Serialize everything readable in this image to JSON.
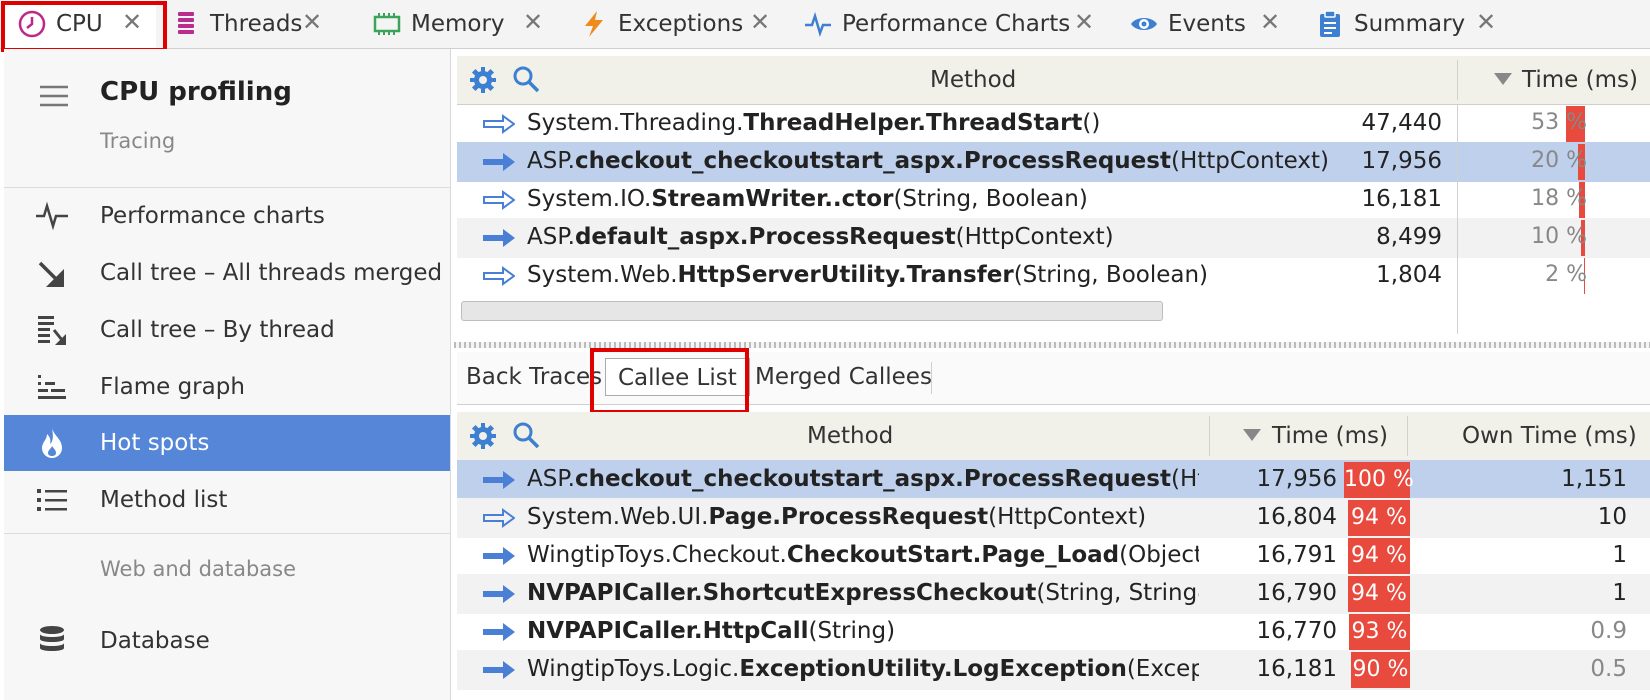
{
  "tabs": [
    {
      "label": "CPU",
      "icon": "clock-icon",
      "active": true
    },
    {
      "label": "Threads",
      "icon": "threads-icon",
      "active": false
    },
    {
      "label": "Memory",
      "icon": "memory-icon",
      "active": false
    },
    {
      "label": "Exceptions",
      "icon": "lightning-icon",
      "active": false
    },
    {
      "label": "Performance Charts",
      "icon": "pulse-icon",
      "active": false
    },
    {
      "label": "Events",
      "icon": "eye-icon",
      "active": false
    },
    {
      "label": "Summary",
      "icon": "clipboard-icon",
      "active": false
    }
  ],
  "tab_close_glyph": "✕",
  "sidebar": {
    "title": "CPU profiling",
    "subtitle": "Tracing",
    "items": [
      {
        "label": "Performance charts",
        "icon": "pulse-icon"
      },
      {
        "label": "Call tree – All threads merged",
        "icon": "arrow-down-right-icon"
      },
      {
        "label": "Call tree – By thread",
        "icon": "call-tree-thread-icon"
      },
      {
        "label": "Flame graph",
        "icon": "flame-graph-icon"
      },
      {
        "label": "Hot spots",
        "icon": "flame-icon",
        "selected": true
      },
      {
        "label": "Method list",
        "icon": "list-icon"
      }
    ],
    "section": "Web and database",
    "section_items": [
      {
        "label": "Database",
        "icon": "database-icon"
      }
    ]
  },
  "top_table": {
    "col_method": "Method",
    "col_time": "Time (ms)",
    "rows": [
      {
        "prefix": "System.Threading.",
        "bold": "ThreadHelper",
        "mid": ".",
        "bold2": "ThreadStart",
        "suffix": "()",
        "time": "47,440",
        "pct": "53 %",
        "pct_value": 53,
        "arrow": "outline",
        "selected": false
      },
      {
        "prefix": "ASP.",
        "bold": "checkout_checkoutstart_aspx",
        "mid": ".",
        "bold2": "ProcessRequest",
        "suffix": "(HttpContext)",
        "time": "17,956",
        "pct": "20 %",
        "pct_value": 20,
        "arrow": "filled",
        "selected": true
      },
      {
        "prefix": "System.IO.",
        "bold": "StreamWriter",
        "mid": "..",
        "bold2": "ctor",
        "suffix": "(String, Boolean)",
        "time": "16,181",
        "pct": "18 %",
        "pct_value": 18,
        "arrow": "outline",
        "selected": false
      },
      {
        "prefix": "ASP.",
        "bold": "default_aspx",
        "mid": ".",
        "bold2": "ProcessRequest",
        "suffix": "(HttpContext)",
        "time": "8,499",
        "pct": "10 %",
        "pct_value": 10,
        "arrow": "filled",
        "selected": false
      },
      {
        "prefix": "System.Web.",
        "bold": "HttpServerUtility",
        "mid": ".",
        "bold2": "Transfer",
        "suffix": "(String, Boolean)",
        "time": "1,804",
        "pct": "2 %",
        "pct_value": 2,
        "arrow": "outline",
        "selected": false
      }
    ]
  },
  "sub_tabs": [
    {
      "label": "Back Traces",
      "active": false
    },
    {
      "label": "Callee List",
      "active": true
    },
    {
      "label": "Merged Callees",
      "active": false
    }
  ],
  "bottom_table": {
    "col_method": "Method",
    "col_time": "Time (ms)",
    "col_own": "Own Time (ms)",
    "rows": [
      {
        "prefix": "ASP.",
        "bold": "checkout_checkoutstart_aspx",
        "mid": ".",
        "bold2": "ProcessRequest",
        "suffix": "(HttpContext)",
        "time": "17,956",
        "pct": "100 %",
        "pct_value": 100,
        "own": "1,151",
        "arrow": "filled",
        "selected": true
      },
      {
        "prefix": "System.Web.UI.",
        "bold": "Page",
        "mid": ".",
        "bold2": "ProcessRequest",
        "suffix": "(HttpContext)",
        "time": "16,804",
        "pct": "94 %",
        "pct_value": 94,
        "own": "10",
        "arrow": "outline",
        "selected": false
      },
      {
        "prefix": "WingtipToys.Checkout.",
        "bold": "CheckoutStart",
        "mid": ".",
        "bold2": "Page_Load",
        "suffix": "(Object, EventArgs)",
        "time": "16,791",
        "pct": "94 %",
        "pct_value": 94,
        "own": "1",
        "arrow": "filled",
        "selected": false
      },
      {
        "prefix": "",
        "bold": "NVPAPICaller",
        "mid": ".",
        "bold2": "ShortcutExpressCheckout",
        "suffix": "(String, String&, String&)",
        "time": "16,790",
        "pct": "94 %",
        "pct_value": 94,
        "own": "1",
        "arrow": "filled",
        "selected": false
      },
      {
        "prefix": "",
        "bold": "NVPAPICaller",
        "mid": ".",
        "bold2": "HttpCall",
        "suffix": "(String)",
        "time": "16,770",
        "pct": "93 %",
        "pct_value": 93,
        "own": "0.9",
        "arrow": "filled",
        "selected": false
      },
      {
        "prefix": "WingtipToys.Logic.",
        "bold": "ExceptionUtility",
        "mid": ".",
        "bold2": "LogException",
        "suffix": "(Exception, String)",
        "time": "16,181",
        "pct": "90 %",
        "pct_value": 90,
        "own": "0.5",
        "arrow": "filled",
        "selected": false
      }
    ]
  },
  "colors": {
    "accent": "#5586d8",
    "bar": "#e84a3e",
    "highlight": "#e00000",
    "selected_row": "#bfd0ec"
  }
}
